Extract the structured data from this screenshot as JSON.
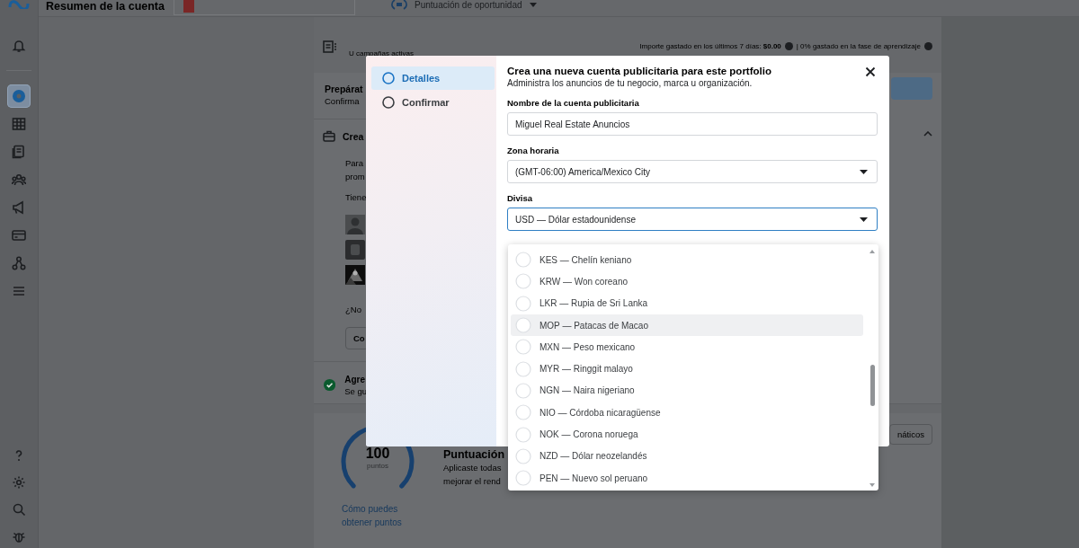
{
  "header": {
    "title": "Resumen de la cuenta",
    "score_label": "Puntuación de oportunidad"
  },
  "sidebar": {
    "items": [
      {
        "kind": "bell",
        "selected": false
      },
      {
        "kind": "home",
        "selected": true
      },
      {
        "kind": "table",
        "selected": false
      },
      {
        "kind": "pages",
        "selected": false
      },
      {
        "kind": "people",
        "selected": false
      },
      {
        "kind": "megaphone",
        "selected": false
      },
      {
        "kind": "card",
        "selected": false
      },
      {
        "kind": "network",
        "selected": false
      },
      {
        "kind": "menu",
        "selected": false
      }
    ],
    "bottom_items": [
      {
        "kind": "help",
        "selected": false
      },
      {
        "kind": "gear",
        "selected": false
      },
      {
        "kind": "search",
        "selected": false
      },
      {
        "kind": "bug",
        "selected": false
      }
    ]
  },
  "summary": {
    "campaigns": "U campañas activas",
    "spend": "Importe gastado en los últimos 7 días: **$0.00**",
    "learning": "| 0% gastado en la fase de aprendizaje"
  },
  "setup_card": {
    "title": "Prepárat",
    "subtitle": "Confirma",
    "section": "Crea",
    "lines": [
      "Para",
      "prom"
    ],
    "question": "Tiene",
    "not_found": "¿No",
    "button": "Co",
    "done_title": "Agre",
    "done_text": "Se gu",
    "done": true
  },
  "score_card": {
    "score": "100",
    "unit": "puntos",
    "link": "Cómo puedes obtener puntos",
    "title": "Puntuación",
    "text": [
      "Aplicaste todas",
      "mejorar el rend"
    ],
    "button": "náticos"
  },
  "dialog": {
    "steps": [
      {
        "label": "Detalles",
        "selected": true
      },
      {
        "label": "Confirmar",
        "selected": false
      }
    ],
    "title": "Crea una nueva cuenta publicitaria para este portfolio",
    "subtitle": "Administra los anuncios de tu negocio, marca u organización.",
    "fields": [
      {
        "kind": "text",
        "label": "Nombre de la cuenta publicitaria",
        "value": "Miguel Real Estate Anuncios",
        "focused": false
      },
      {
        "kind": "select",
        "label": "Zona horaria",
        "value": "(GMT-06:00) America/Mexico City",
        "focused": false
      },
      {
        "kind": "select",
        "label": "Divisa",
        "value": "USD — Dólar estadounidense",
        "focused": true
      }
    ],
    "currency_options": [
      {
        "label": "KES — Chelín keniano",
        "selected": false,
        "hovered": false
      },
      {
        "label": "KRW — Won coreano",
        "selected": false,
        "hovered": false
      },
      {
        "label": "LKR — Rupia de Sri Lanka",
        "selected": false,
        "hovered": false
      },
      {
        "label": "MOP — Patacas de Macao",
        "selected": false,
        "hovered": true
      },
      {
        "label": "MXN — Peso mexicano",
        "selected": false,
        "hovered": false
      },
      {
        "label": "MYR — Ringgit malayo",
        "selected": false,
        "hovered": false
      },
      {
        "label": "NGN — Naira nigeriano",
        "selected": false,
        "hovered": false
      },
      {
        "label": "NIO — Córdoba nicaragüense",
        "selected": false,
        "hovered": false
      },
      {
        "label": "NOK — Corona noruega",
        "selected": false,
        "hovered": false
      },
      {
        "label": "NZD — Dólar neozelandés",
        "selected": false,
        "hovered": false
      },
      {
        "label": "PEN — Nuevo sol peruano",
        "selected": false,
        "hovered": false
      }
    ]
  }
}
